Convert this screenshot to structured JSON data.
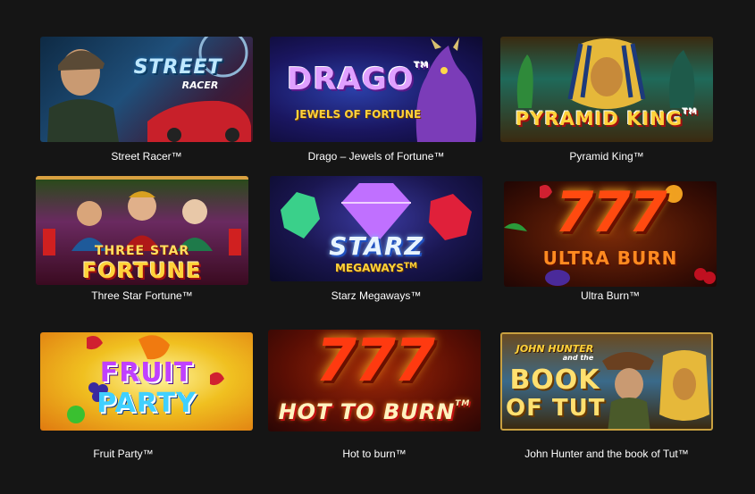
{
  "colors": {
    "background": "#151515",
    "caption_text": "#ffffff"
  },
  "games": [
    {
      "id": "street-racer",
      "caption": "Street Racer™",
      "art": {
        "line1": "STREET",
        "line2": "RACER",
        "icons": [
          "driver-figure",
          "speedometer-icon",
          "red-sports-car"
        ]
      }
    },
    {
      "id": "drago",
      "caption": "Drago – Jewels of Fortune™",
      "art": {
        "line1": "DRAGO",
        "tm": "TM",
        "line2": "JEWELS OF FORTUNE",
        "icons": [
          "purple-dragon-figure"
        ]
      }
    },
    {
      "id": "pyramid-king",
      "caption": "Pyramid King™",
      "art": {
        "line1": "PYRAMID KING",
        "tm": "TM",
        "icons": [
          "pharaoh-mask",
          "cobra-figure",
          "anubis-figure"
        ]
      }
    },
    {
      "id": "three-star-fortune",
      "caption": "Three Star Fortune™",
      "art": {
        "line1": "THREE STAR",
        "line2": "FORTUNE",
        "icons": [
          "three-sages-figures",
          "firecracker-icon"
        ]
      }
    },
    {
      "id": "starz-megaways",
      "caption": "Starz Megaways™",
      "art": {
        "line1": "STARZ",
        "line2": "MEGAWAYS",
        "tm": "TM",
        "icons": [
          "green-gem",
          "purple-diamond",
          "red-gem"
        ]
      }
    },
    {
      "id": "ultra-burn",
      "caption": "Ultra Burn™",
      "art": {
        "line1": "777",
        "line2": "ULTRA BURN",
        "icons": [
          "strawberry-icon",
          "watermelon-icon",
          "plum-icon",
          "cherry-icon"
        ]
      }
    },
    {
      "id": "fruit-party",
      "caption": "Fruit Party™",
      "art": {
        "line1": "FRUIT",
        "line2": "PARTY",
        "icons": [
          "strawberry-icon",
          "grapes-icon",
          "apple-icon",
          "orange-icon"
        ]
      }
    },
    {
      "id": "hot-to-burn",
      "caption": "Hot to burn™",
      "art": {
        "line1": "777",
        "line2": "HOT TO BURN",
        "tm": "TM"
      }
    },
    {
      "id": "book-of-tut",
      "caption": "John Hunter and the book of Tut™",
      "art": {
        "line0": "JOHN HUNTER",
        "line0b": "and the",
        "line1": "BOOK",
        "line2": "OF TUT",
        "icons": [
          "explorer-figure",
          "pharaoh-mask"
        ]
      }
    }
  ]
}
